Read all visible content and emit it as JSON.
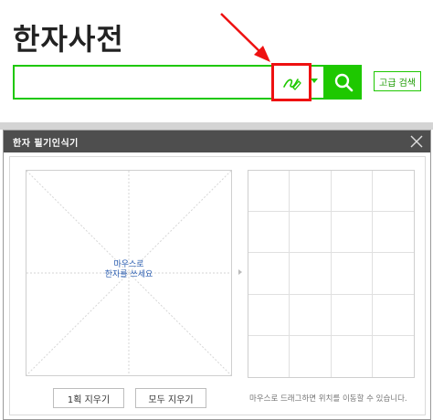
{
  "header": {
    "title": "한자사전"
  },
  "search": {
    "value": "",
    "placeholder": "",
    "handwrite_icon": "pen-handwriting-icon",
    "dropdown_icon": "caret-down-icon",
    "search_icon": "search-icon",
    "advanced_label": "고급 검색"
  },
  "dialog": {
    "title": "한자 필기인식기",
    "close_icon": "close-icon",
    "pad_hint_line1": "마우스로",
    "pad_hint_line2": "한자를 쓰세요",
    "clear_one_label": "1획 지우기",
    "clear_all_label": "모두 지우기",
    "drag_hint": "마우스로 드래그하면 위치를 이동할 수 있습니다."
  },
  "colors": {
    "accent_green": "#1ec800",
    "highlight_red": "#ee1111",
    "dialog_header": "#4e4e4e"
  }
}
